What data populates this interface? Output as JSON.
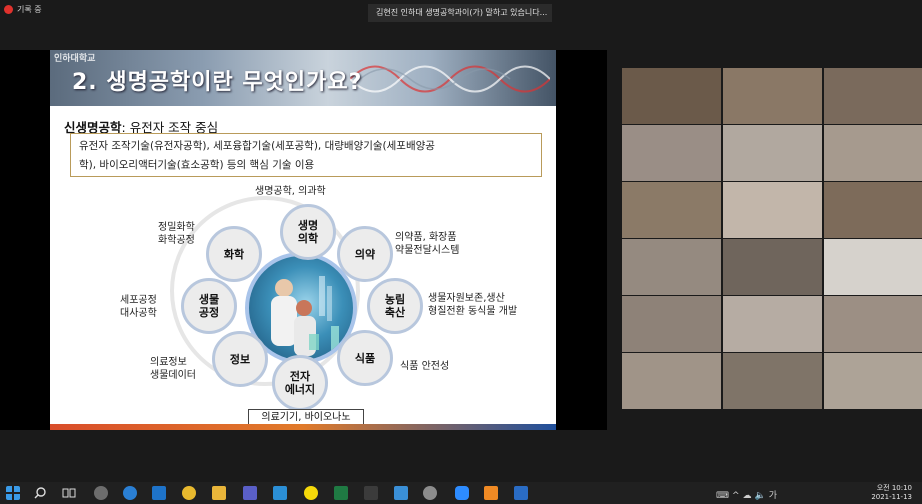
{
  "window": {
    "recording_label": "기록 중",
    "speaker_banner": "김현진 인하대 생명공학과이(가) 말하고 있습니다..."
  },
  "slide": {
    "logo_text": "인하대학교",
    "title": "2. 생명공학이란 무엇인가요?",
    "subtitle_bold": "신생명공학",
    "subtitle_rest": ": 유전자 조작 중심",
    "definition_line1": "유전자 조작기술(유전자공학), 세포융합기술(세포공학), 대량배양기술(세포배양공",
    "definition_line2": "학), 바이오리액터기술(효소공학) 등의 핵심 기술 이용",
    "nodes": [
      {
        "label": "생명\n의학",
        "desc": "생명공학, 의과학"
      },
      {
        "label": "의약",
        "desc": "의약품, 화장품\n약물전달시스템"
      },
      {
        "label": "농림\n축산",
        "desc": "생물자원보존,생산\n형질전환 동식물 개발"
      },
      {
        "label": "식품",
        "desc": "식품 안전성"
      },
      {
        "label": "전자\n에너지",
        "desc": "의료기기, 바이오나노"
      },
      {
        "label": "정보",
        "desc": "의료정보\n생물데이터"
      },
      {
        "label": "생물\n공정",
        "desc": "세포공정\n대사공학"
      },
      {
        "label": "화학",
        "desc": "정밀화학\n화학공정"
      }
    ]
  },
  "taskbar": {
    "time_label": "오전 10:10",
    "date_label": "2021-11-13",
    "ime_label": "가"
  }
}
